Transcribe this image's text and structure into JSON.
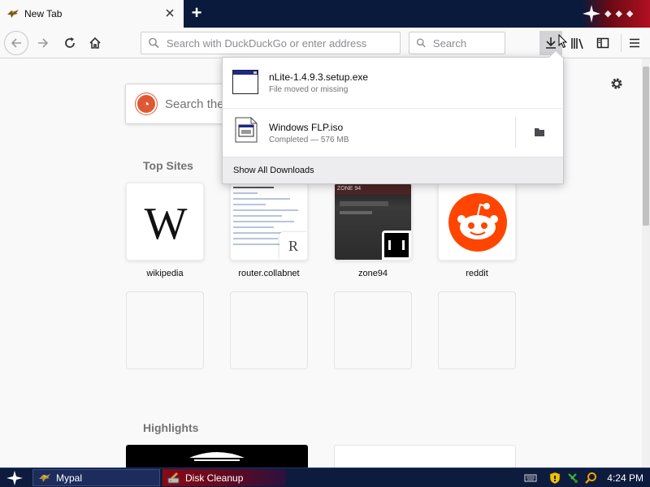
{
  "window": {
    "tab_title": "New Tab",
    "tab_favicon": "pale-moon-bird-icon"
  },
  "navbar": {
    "url_placeholder": "Search with DuckDuckGo or enter address",
    "search_placeholder": "Search"
  },
  "newtab": {
    "search_text": "Search the",
    "top_sites_title": "Top Sites",
    "highlights_title": "Highlights",
    "sites": [
      {
        "label": "wikipedia",
        "icon": "W"
      },
      {
        "label": "router.collabnet",
        "badge": "R"
      },
      {
        "label": "zone94",
        "header_text": "ZONE 94"
      },
      {
        "label": "reddit"
      }
    ]
  },
  "downloads": {
    "items": [
      {
        "filename": "nLite-1.4.9.3.setup.exe",
        "status": "File moved or missing"
      },
      {
        "filename": "Windows FLP.iso",
        "status": "Completed — 576 MB"
      }
    ],
    "footer_label": "Show All Downloads"
  },
  "taskbar": {
    "items": [
      {
        "label": "Mypal"
      },
      {
        "label": "Disk Cleanup"
      }
    ],
    "clock": "4:24 PM"
  },
  "colors": {
    "tabbar_bg": "#0a1a3c",
    "accent_red": "#b01020",
    "reddit_orange": "#ff4500",
    "ddg_orange": "#de5833"
  }
}
